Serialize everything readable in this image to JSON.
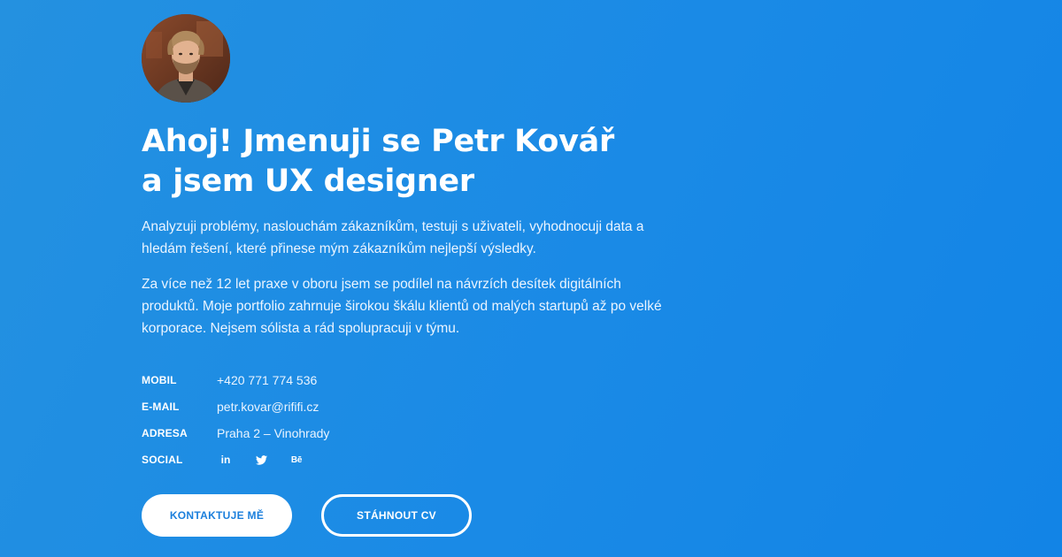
{
  "profile": {
    "avatar_alt": "Petr Kovář"
  },
  "hero": {
    "heading_line1": "Ahoj! Jmenuji se Petr Kovář",
    "heading_line2": "a jsem UX designer",
    "paragraph1": "Analyzuji problémy, naslouchám zákazníkům, testuji s uživateli, vyhodnocuji data a hledám řešení, které přinese mým zákazníkům nejlepší výsledky.",
    "paragraph2": "Za více než 12 let praxe v oboru jsem se podílel na návrzích desítek digitálních produktů. Moje portfolio zahrnuje širokou škálu klientů od malých startupů až po velké korporace. Nejsem sólista a rád spolupracuji v týmu."
  },
  "contacts": {
    "mobile_label": "MOBIL",
    "mobile_value": "+420 771 774 536",
    "email_label": "E-MAIL",
    "email_value": "petr.kovar@rififi.cz",
    "address_label": "ADRESA",
    "address_value": "Praha 2 – Vinohrady",
    "social_label": "SOCIAL",
    "social": {
      "linkedin_text": "in",
      "behance_text": "Bē",
      "icons": [
        "linkedin-icon",
        "twitter-icon",
        "behance-icon"
      ]
    }
  },
  "buttons": {
    "contact_label": "KONTAKTUJE MĚ",
    "cv_label": "STÁHNOUT CV"
  },
  "colors": {
    "background_start": "#2491e0",
    "background_end": "#1284e6",
    "primary_button_text": "#1b7fdc",
    "text": "#ffffff"
  }
}
